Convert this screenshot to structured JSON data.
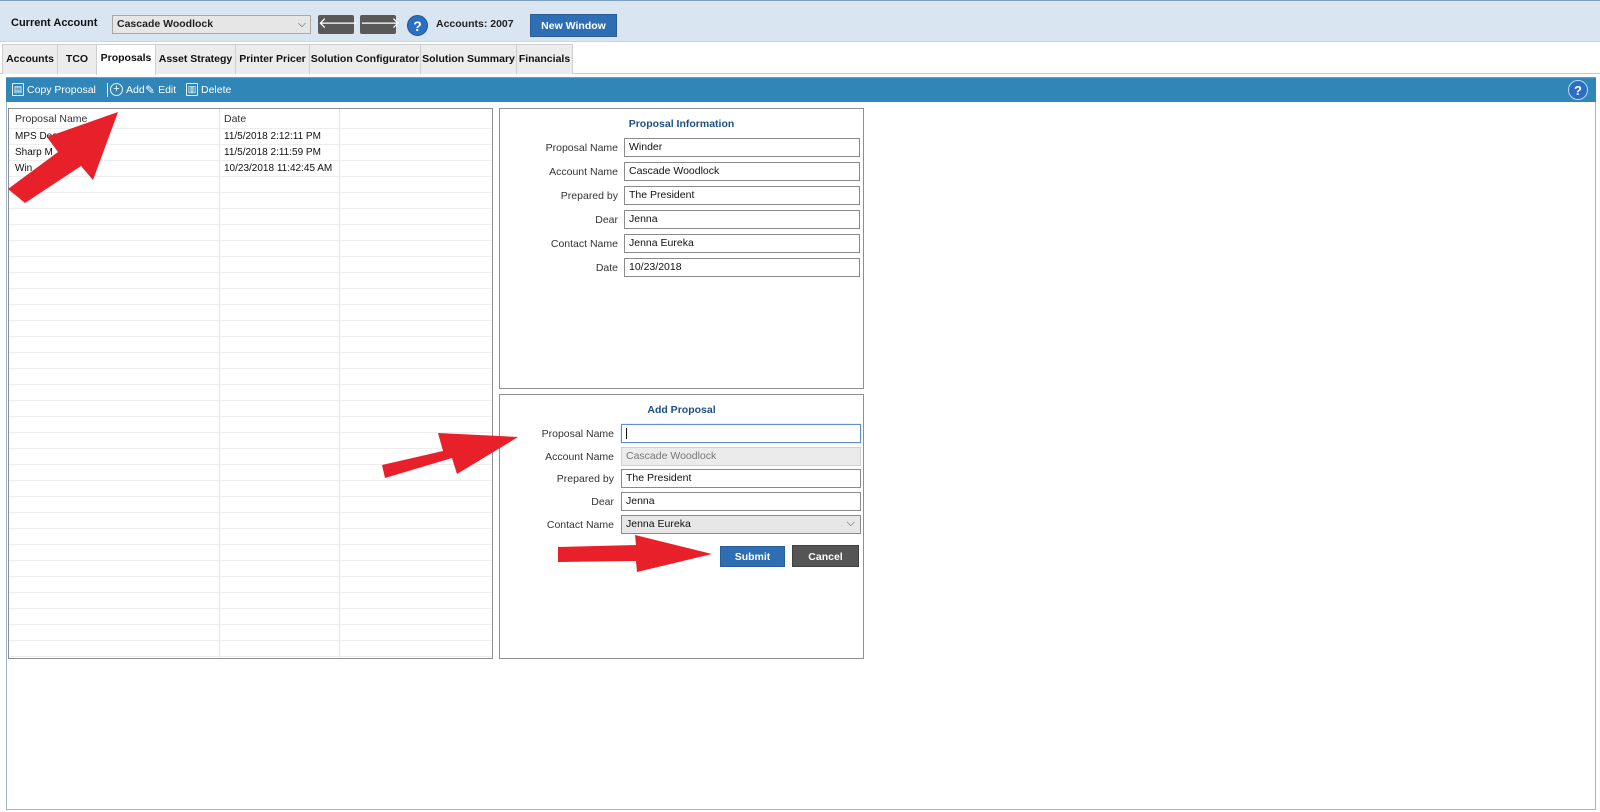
{
  "topbar": {
    "current_account_label": "Current Account",
    "account_selected": "Cascade Woodlock",
    "back_glyph": "🡐",
    "forward_glyph": "🡒",
    "help_glyph": "?",
    "accounts_count": "Accounts: 2007",
    "new_window_label": "New Window"
  },
  "tabs": [
    {
      "label": "Accounts",
      "active": false
    },
    {
      "label": "TCO",
      "active": false
    },
    {
      "label": "Proposals",
      "active": true
    },
    {
      "label": "Asset Strategy",
      "active": false
    },
    {
      "label": "Printer Pricer",
      "active": false
    },
    {
      "label": "Solution Configurator",
      "active": false
    },
    {
      "label": "Solution Summary",
      "active": false
    },
    {
      "label": "Financials",
      "active": false
    }
  ],
  "toolbar": {
    "copy_label": "Copy Proposal",
    "add_label": "Add",
    "edit_label": "Edit",
    "delete_label": "Delete",
    "help_glyph": "?"
  },
  "grid": {
    "columns": [
      "Proposal Name",
      "Date"
    ],
    "rows": [
      {
        "name": "MPS Dea",
        "date": "11/5/2018 2:12:11 PM"
      },
      {
        "name": "Sharp M",
        "date": "11/5/2018 2:11:59 PM"
      },
      {
        "name": "Win",
        "date": "10/23/2018 11:42:45 AM"
      }
    ]
  },
  "proposal_info": {
    "title": "Proposal Information",
    "fields": [
      {
        "label": "Proposal Name",
        "value": "Winder"
      },
      {
        "label": "Account Name",
        "value": "Cascade Woodlock"
      },
      {
        "label": "Prepared by",
        "value": "The President"
      },
      {
        "label": "Dear",
        "value": "Jenna"
      },
      {
        "label": "Contact Name",
        "value": "Jenna Eureka"
      },
      {
        "label": "Date",
        "value": "10/23/2018"
      }
    ]
  },
  "add_proposal": {
    "title": "Add Proposal",
    "proposal_name_label": "Proposal Name",
    "proposal_name_value": "",
    "account_name_label": "Account Name",
    "account_name_value": "Cascade Woodlock",
    "prepared_by_label": "Prepared by",
    "prepared_by_value": "The President",
    "dear_label": "Dear",
    "dear_value": "Jenna",
    "contact_name_label": "Contact Name",
    "contact_name_value": "Jenna Eureka",
    "submit_label": "Submit",
    "cancel_label": "Cancel"
  },
  "colors": {
    "toolbar_bg": "#2f86b7",
    "topbar_bg": "#d9e5f1",
    "primary_button": "#2e6eb5",
    "secondary_button": "#555555",
    "annotation_arrow": "#e8202a",
    "panel_title": "#1d4f86"
  },
  "icons": {
    "copy": "copy-icon",
    "add": "plus-circle-icon",
    "edit": "pencil-icon",
    "delete": "trash-icon",
    "help": "question-icon",
    "dropdown": "chevron-down-icon",
    "back": "arrow-left-icon",
    "forward": "arrow-right-icon"
  }
}
